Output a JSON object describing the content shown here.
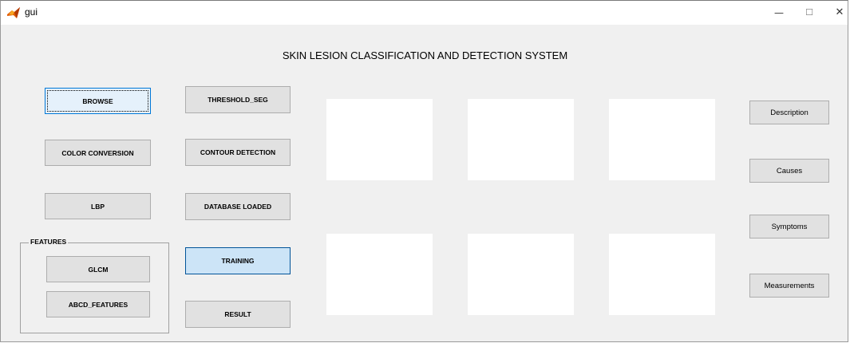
{
  "window": {
    "title": "gui",
    "minimize": "—",
    "maximize": "☐",
    "close": "✕"
  },
  "heading": "SKIN LESION CLASSIFICATION AND DETECTION SYSTEM",
  "buttons": {
    "browse": "BROWSE",
    "threshold_seg": "THRESHOLD_SEG",
    "color_conversion": "COLOR CONVERSION",
    "contour_detection": "CONTOUR DETECTION",
    "lbp": "LBP",
    "database_loaded": "DATABASE LOADED",
    "training": "TRAINING",
    "result": "RESULT",
    "glcm": "GLCM",
    "abcd_features": "ABCD_FEATURES",
    "description": "Description",
    "causes": "Causes",
    "symptoms": "Symptoms",
    "measurements": "Measurements"
  },
  "features_panel": {
    "title": "FEATURES"
  },
  "colors": {
    "focus_border": "#0078d7",
    "active_bg": "#cce4f7",
    "button_bg": "#e1e1e1"
  }
}
